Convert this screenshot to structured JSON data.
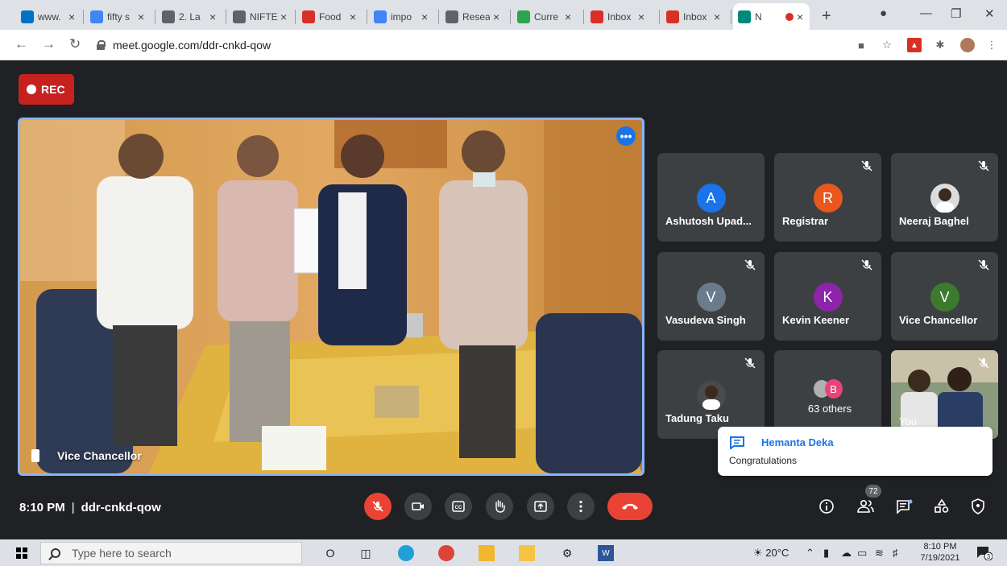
{
  "browser": {
    "tabs": [
      {
        "title": "www.",
        "icon": "mail-favicon-icon",
        "color": "#0072c6"
      },
      {
        "title": "fifty s",
        "icon": "google-favicon-icon",
        "color": "#4285f4"
      },
      {
        "title": "2. La",
        "icon": "globe-favicon-icon",
        "color": "#5f6368"
      },
      {
        "title": "NIFTE",
        "icon": "globe-favicon-icon",
        "color": "#5f6368"
      },
      {
        "title": "Food",
        "icon": "food-favicon-icon",
        "color": "#d93025"
      },
      {
        "title": "impo",
        "icon": "google-favicon-icon",
        "color": "#4285f4"
      },
      {
        "title": "Resea",
        "icon": "globe-favicon-icon",
        "color": "#5f6368"
      },
      {
        "title": "Curre",
        "icon": "r-favicon-icon",
        "color": "#2ea44f"
      },
      {
        "title": "Inbox",
        "icon": "gmail-favicon-icon",
        "color": "#d93025"
      },
      {
        "title": "Inbox",
        "icon": "gmail-favicon-icon",
        "color": "#d93025"
      },
      {
        "title": "N",
        "icon": "meet-favicon-icon",
        "color": "#00897b",
        "active": true
      }
    ],
    "new_tab": "+",
    "url": "meet.google.com/ddr-cnkd-qow"
  },
  "meet": {
    "rec_label": "REC",
    "main_speaker": "Vice Chancellor",
    "participants": [
      {
        "name": "Ashutosh Upad...",
        "initial": "A",
        "color": "#1a73e8",
        "muted": false
      },
      {
        "name": "Registrar",
        "initial": "R",
        "color": "#e8571e",
        "muted": true
      },
      {
        "name": "Neeraj Baghel",
        "initial": "",
        "color": "#dcdcdc",
        "muted": true,
        "photo": true
      },
      {
        "name": "Vasudeva Singh",
        "initial": "V",
        "color": "#6b7b8c",
        "muted": true
      },
      {
        "name": "Kevin Keener",
        "initial": "K",
        "color": "#8e24aa",
        "muted": true
      },
      {
        "name": "Vice Chancellor",
        "initial": "V",
        "color": "#3c7a2f",
        "muted": true
      },
      {
        "name": "Tadung Taku",
        "initial": "",
        "color": "#4a4a4a",
        "muted": true,
        "photo": true
      },
      {
        "name": "63 others",
        "initial": "B",
        "color": "#e8447a",
        "muted": false
      },
      {
        "name": "You",
        "initial": "",
        "color": "#6d7b6a",
        "muted": true,
        "photo": true
      }
    ],
    "time": "8:10 PM",
    "meeting_code": "ddr-cnkd-qow",
    "people_count": "72",
    "chat": {
      "sender": "Hemanta Deka",
      "message": "Congratulations"
    }
  },
  "taskbar": {
    "search_placeholder": "Type here to search",
    "weather": "20°C",
    "time": "8:10 PM",
    "date": "7/19/2021",
    "notifications": "3"
  }
}
